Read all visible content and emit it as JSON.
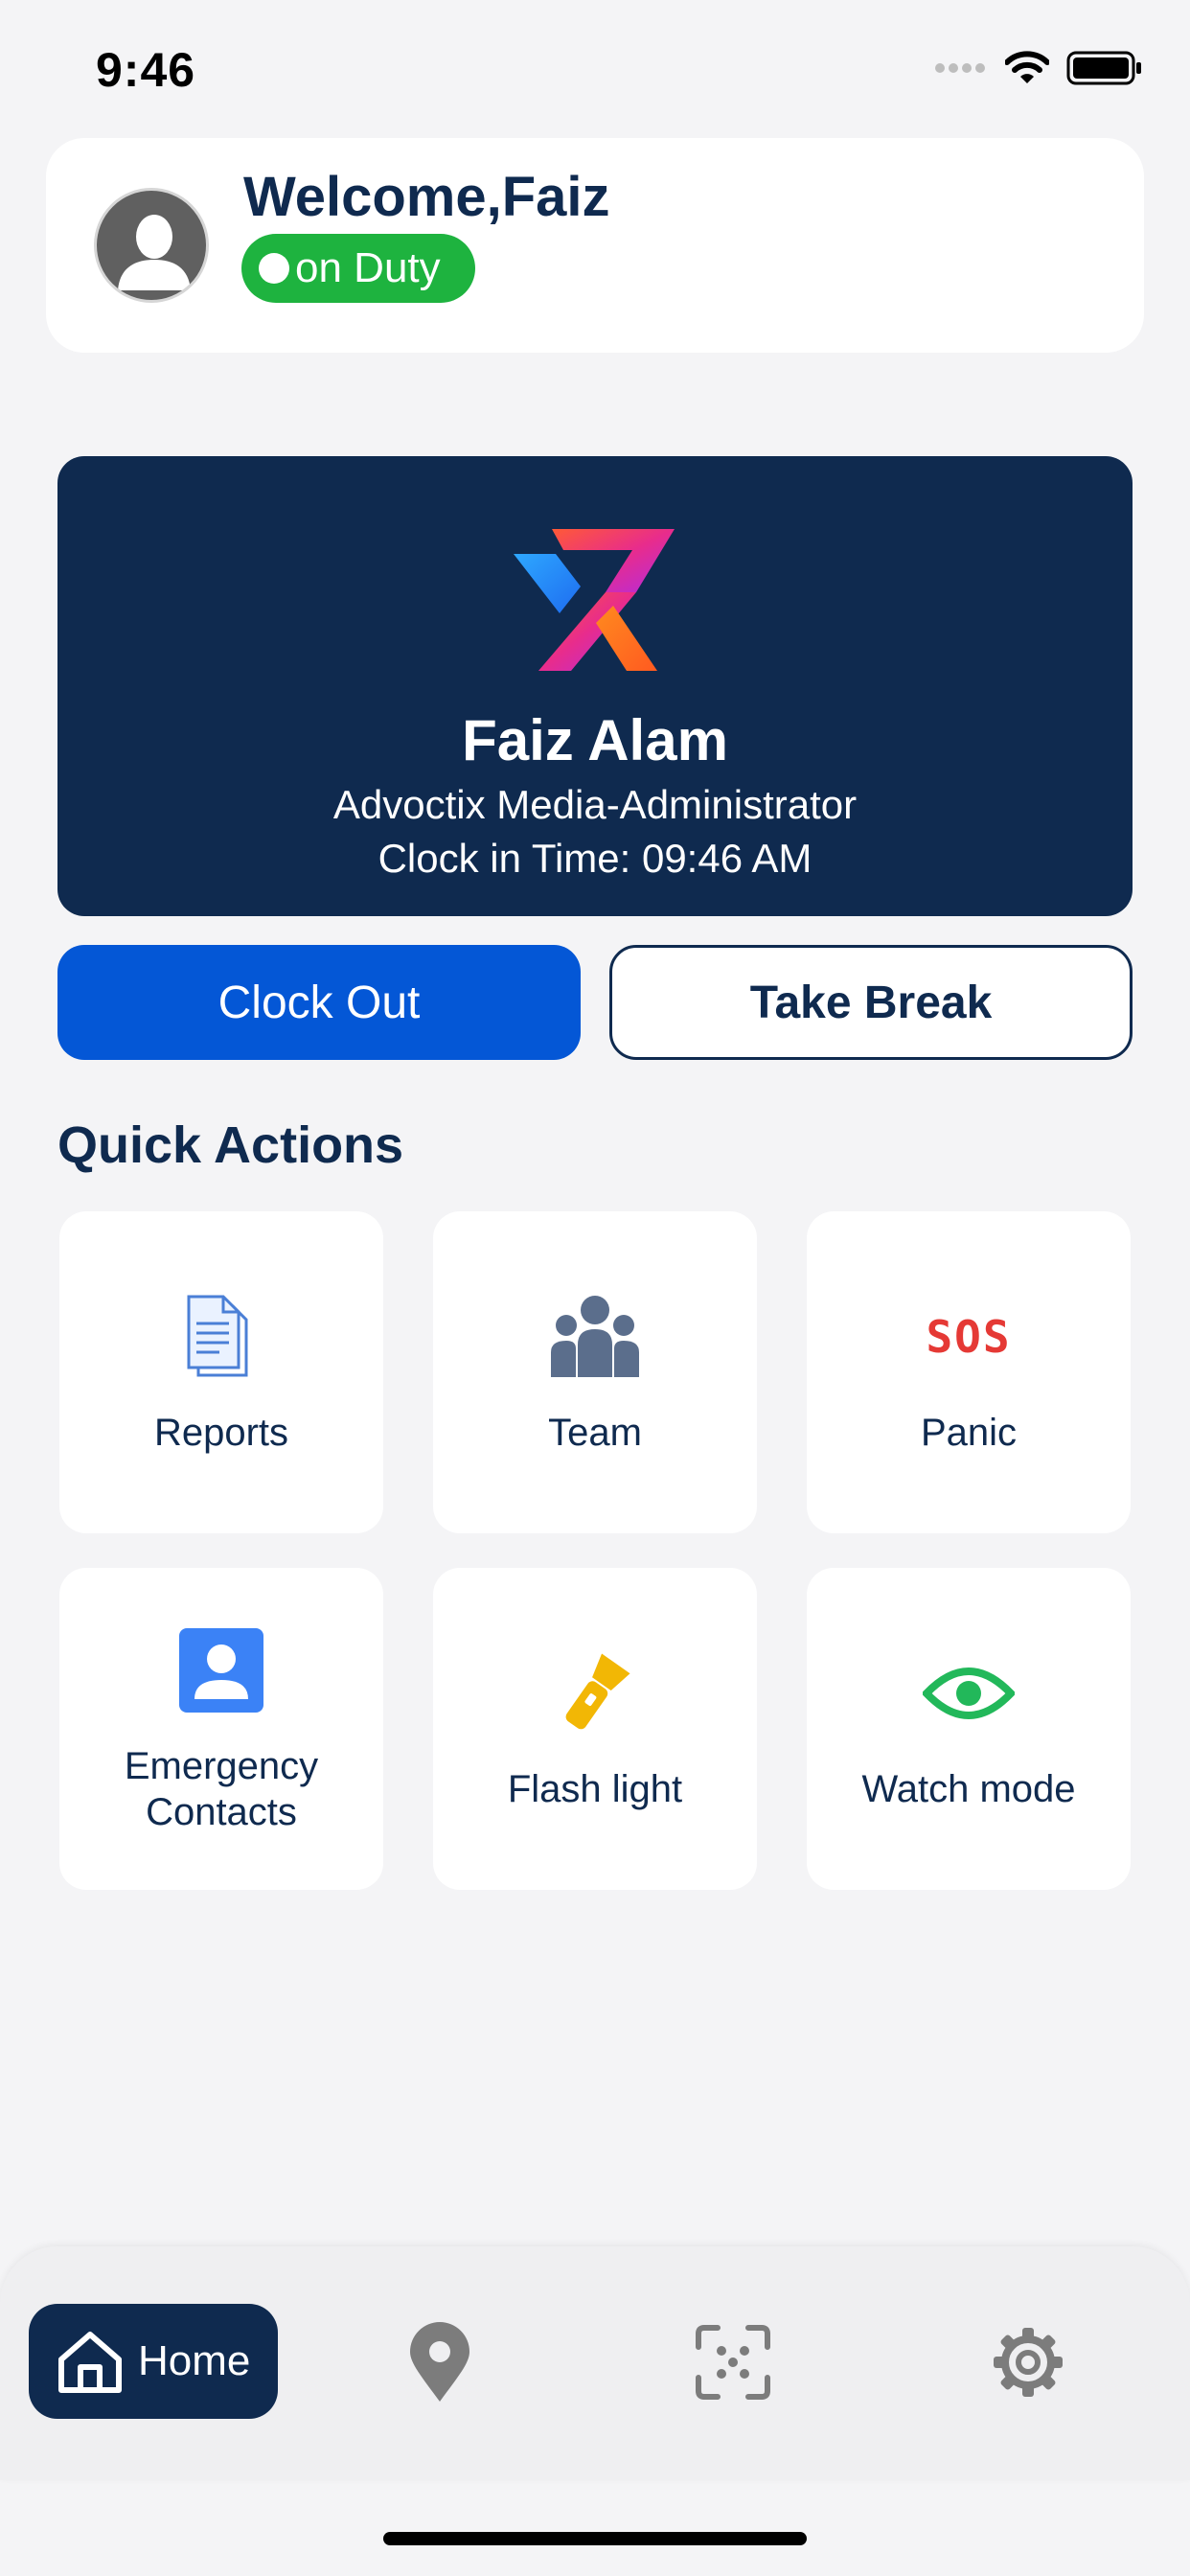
{
  "status_bar": {
    "time": "9:46"
  },
  "header": {
    "welcome": "Welcome,Faiz",
    "status": "on Duty"
  },
  "profile": {
    "name": "Faiz Alam",
    "org": "Advoctix Media-Administrator",
    "clock_in": "Clock in Time: 09:46 AM"
  },
  "actions": {
    "clock_out": "Clock Out",
    "take_break": "Take Break"
  },
  "quick_actions": {
    "title": "Quick Actions",
    "tiles": [
      {
        "label": "Reports",
        "icon": "document-icon"
      },
      {
        "label": "Team",
        "icon": "team-icon"
      },
      {
        "label": "Panic",
        "icon": "sos-icon"
      },
      {
        "label": "Emergency Contacts",
        "icon": "contact-icon"
      },
      {
        "label": "Flash light",
        "icon": "flashlight-icon"
      },
      {
        "label": "Watch mode",
        "icon": "eye-icon"
      }
    ],
    "sos_text": "SOS"
  },
  "nav": {
    "home": "Home"
  },
  "colors": {
    "navy": "#0F2A4F",
    "blue": "#0457D6",
    "green": "#1EB33F",
    "red": "#E53935",
    "amber": "#F2B705",
    "eye_green": "#22B85A"
  }
}
